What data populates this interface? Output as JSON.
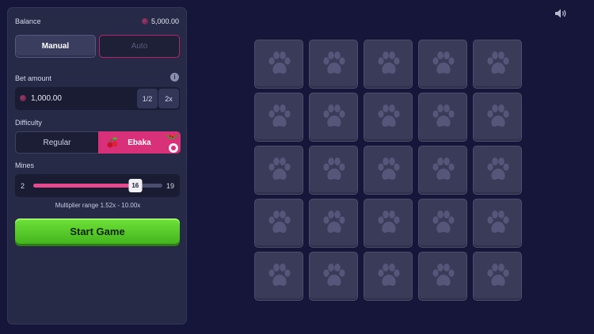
{
  "balance": {
    "label": "Balance",
    "value": "5,000.00"
  },
  "modes": {
    "manual": "Manual",
    "auto": "Auto"
  },
  "bet": {
    "label": "Bet amount",
    "value": "1,000.00",
    "half": "1/2",
    "double": "2x"
  },
  "difficulty": {
    "label": "Difficulty",
    "regular": "Regular",
    "ebaka": "Ebaka"
  },
  "mines": {
    "label": "Mines",
    "min": "2",
    "max": "19",
    "value": "16"
  },
  "multiplier": "Multiplier range 1.52x - 10.00x",
  "start_label": "Start Game",
  "colors": {
    "accent": "#d8317a",
    "start": "#5ccf2c",
    "background": "#15163a",
    "tile": "#3a3b58"
  },
  "icons": {
    "sound": "speaker-icon",
    "tile": "paw-icon",
    "info": "info-icon"
  },
  "grid": {
    "rows": 5,
    "cols": 5
  }
}
